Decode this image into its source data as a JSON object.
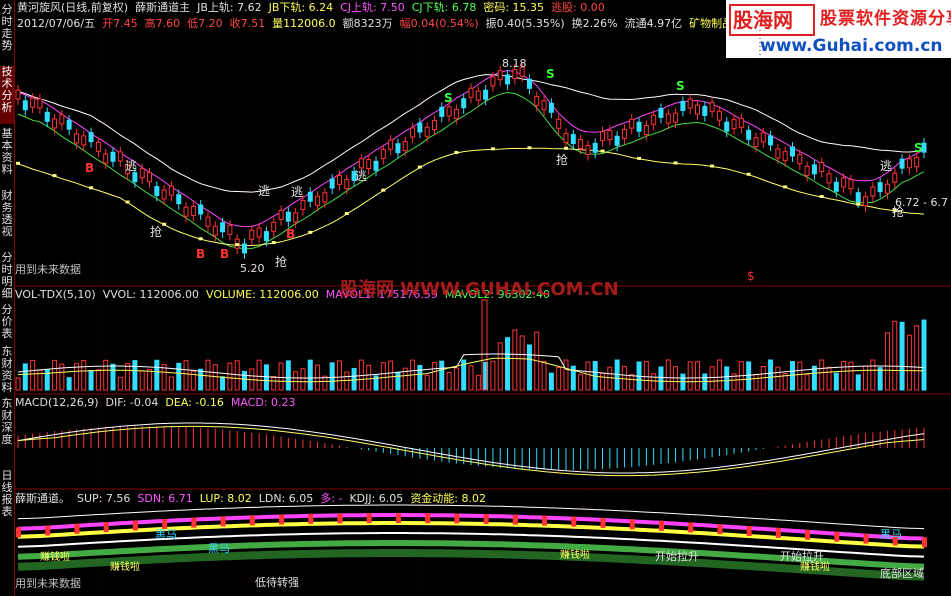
{
  "sidebar": {
    "tabs": [
      {
        "label": "分时走势",
        "active": false
      },
      {
        "label": "技术分析",
        "active": true
      },
      {
        "label": "基本资料",
        "active": false
      },
      {
        "label": "财务透视",
        "active": false
      },
      {
        "label": "分时明细",
        "active": false
      },
      {
        "label": "分价表",
        "active": false
      },
      {
        "label": "东财资料",
        "active": false
      },
      {
        "label": "东财深度",
        "active": false
      },
      {
        "label": "日线报表",
        "active": false
      }
    ]
  },
  "header": {
    "line1": [
      {
        "text": "黄河旋风(日线,前复权)",
        "color": "#e0e0e0"
      },
      {
        "text": "薛斯通道主",
        "color": "#e0e0e0"
      },
      {
        "text": "JB上轨: 7.62",
        "color": "#e0e0e0"
      },
      {
        "text": "JB下轨: 6.24",
        "color": "#ffff55"
      },
      {
        "text": "CJ上轨: 7.50",
        "color": "#ff55ff"
      },
      {
        "text": "CJ下轨: 6.78",
        "color": "#55ff55"
      },
      {
        "text": "密码: 15.35",
        "color": "#ffff55"
      },
      {
        "text": "逃股: 0.00",
        "color": "#ff4444"
      }
    ],
    "line2": [
      {
        "text": "2012/07/06/五",
        "color": "#e0e0e0"
      },
      {
        "text": "开7.45",
        "color": "#ff4444"
      },
      {
        "text": "高7.60",
        "color": "#ff4444"
      },
      {
        "text": "低7.20",
        "color": "#ff4444"
      },
      {
        "text": "收7.51",
        "color": "#ff4444"
      },
      {
        "text": "量112006.0",
        "color": "#ffff55"
      },
      {
        "text": "额8323万",
        "color": "#e0e0e0"
      },
      {
        "text": "幅0.04(0.54%)",
        "color": "#ff4444"
      },
      {
        "text": "振0.40(5.35%)",
        "color": "#e0e0e0"
      },
      {
        "text": "换2.26%",
        "color": "#e0e0e0"
      },
      {
        "text": "流通4.97亿",
        "color": "#e0e0e0"
      },
      {
        "text": "矿物制品",
        "color": "#ffff55"
      }
    ]
  },
  "logo": {
    "title": "股海网",
    "slogan": "股票软件资源分享",
    "url": "www.Guhai.com.cn",
    "colors": {
      "red": "#e02020",
      "blue": "#1050c0"
    }
  },
  "main_panel": {
    "future_label": "用到未来数据",
    "price_labels": {
      "high": "8.18",
      "low": "5.20",
      "right": "6.72 - 6.7"
    },
    "annotations": {
      "buy": "B",
      "sell_s": "S",
      "escape": "逃",
      "grab": "抢",
      "dollar": "$"
    },
    "watermark": "股海网 WWW.GUHAI.COM.CN"
  },
  "vol_panel": {
    "header": [
      {
        "text": "VOL-TDX(5,10)",
        "color": "#e0e0e0"
      },
      {
        "text": "VVOL: 112006.00",
        "color": "#e0e0e0"
      },
      {
        "text": "VOLUME: 112006.00",
        "color": "#ffff55"
      },
      {
        "text": "MAVOL1: 175176.59",
        "color": "#ff55ff"
      },
      {
        "text": "MAVOL2: 96302.40",
        "color": "#55ff55"
      }
    ]
  },
  "macd_panel": {
    "header": [
      {
        "text": "MACD(12,26,9)",
        "color": "#e0e0e0"
      },
      {
        "text": "DIF: -0.04",
        "color": "#e0e0e0"
      },
      {
        "text": "DEA: -0.16",
        "color": "#ffff55"
      },
      {
        "text": "MACD: 0.23",
        "color": "#ff55ff"
      }
    ]
  },
  "xue_panel": {
    "header": [
      {
        "text": "薛斯通道。",
        "color": "#e0e0e0"
      },
      {
        "text": "SUP: 7.56",
        "color": "#e0e0e0"
      },
      {
        "text": "SDN: 6.71",
        "color": "#ff55ff"
      },
      {
        "text": "LUP: 8.02",
        "color": "#ffff55"
      },
      {
        "text": "LDN: 6.05",
        "color": "#e0e0e0"
      },
      {
        "text": "多: -",
        "color": "#ff55ff"
      },
      {
        "text": "KDJJ: 6.05",
        "color": "#e0e0e0"
      },
      {
        "text": "资金动能: 8.02",
        "color": "#ffff55"
      }
    ],
    "labels": {
      "black_horse": "黑马",
      "money": "赚钱啦",
      "low": "低",
      "start_rise": "开始拉升",
      "wait": "低待转强",
      "bottom": "底部区域"
    },
    "future_label": "用到未来数据"
  }
}
